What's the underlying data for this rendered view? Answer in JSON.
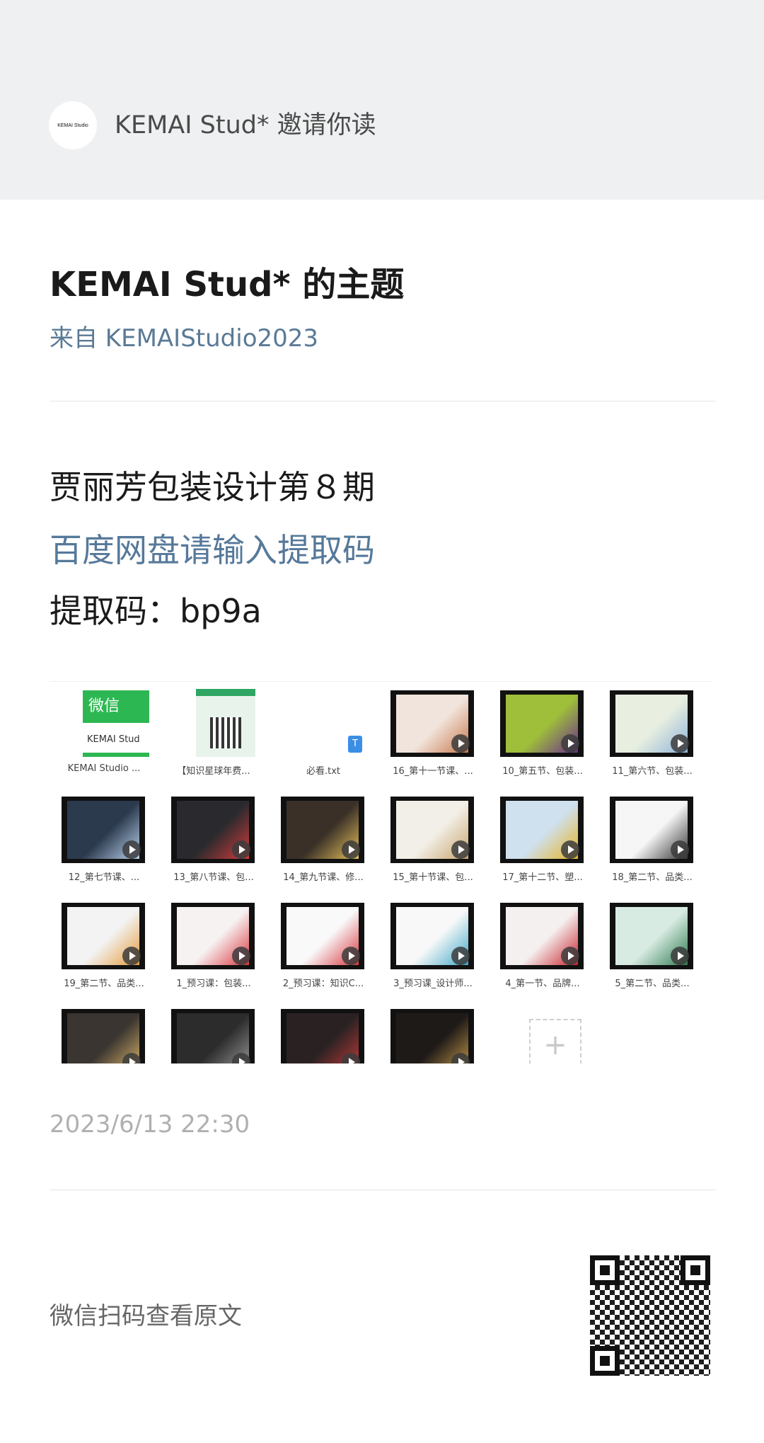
{
  "header": {
    "avatar_text": "KEMAI Studio",
    "invite_text": "KEMAI Stud* 邀请你读"
  },
  "topic": {
    "title": "KEMAI Stud* 的主题",
    "from": "来自 KEMAIStudio2023"
  },
  "post": {
    "title": "贾丽芳包装设计第８期",
    "link_text": "百度网盘请输入提取码",
    "code_text": "提取码：bp9a"
  },
  "files": [
    {
      "caption": "KEMAI Studio ...",
      "kind": "wechat-card",
      "card_top": "微信",
      "card_bottom": "KEMAI Stud"
    },
    {
      "caption": "【知识星球年费...",
      "kind": "qr-card"
    },
    {
      "caption": "必看.txt",
      "kind": "txt",
      "file_badge": "T"
    },
    {
      "caption": "16_第十一节课、...",
      "kind": "video",
      "thumb_color": "#f1e4dc",
      "accent": "#c7784a"
    },
    {
      "caption": "10_第五节、包装...",
      "kind": "video",
      "thumb_color": "#9fbf3a",
      "accent": "#6a2c8f"
    },
    {
      "caption": "11_第六节、包装...",
      "kind": "video",
      "thumb_color": "#e8efe0",
      "accent": "#8fb3d9"
    },
    {
      "caption": "12_第七节课、...",
      "kind": "video",
      "thumb_color": "#2c3a4e",
      "accent": "#b9d4ee"
    },
    {
      "caption": "13_第八节课、包...",
      "kind": "video",
      "thumb_color": "#2a2a2e",
      "accent": "#d33b3b"
    },
    {
      "caption": "14_第九节课、修...",
      "kind": "video",
      "thumb_color": "#3a3028",
      "accent": "#e6c15a"
    },
    {
      "caption": "15_第十节课、包...",
      "kind": "video",
      "thumb_color": "#f2efe8",
      "accent": "#c9a46a"
    },
    {
      "caption": "17_第十二节、塑...",
      "kind": "video",
      "thumb_color": "#cfe0ee",
      "accent": "#e6b422"
    },
    {
      "caption": "18_第二节、品类...",
      "kind": "video",
      "thumb_color": "#f6f6f6",
      "accent": "#333333"
    },
    {
      "caption": "19_第二节、品类...",
      "kind": "video",
      "thumb_color": "#f3f3f3",
      "accent": "#e39a3a"
    },
    {
      "caption": "1_预习课：包装...",
      "kind": "video",
      "thumb_color": "#f7f2f2",
      "accent": "#d9363e"
    },
    {
      "caption": "2_预习课：知识C...",
      "kind": "video",
      "thumb_color": "#f9f9f9",
      "accent": "#d9363e"
    },
    {
      "caption": "3_预习课_设计师...",
      "kind": "video",
      "thumb_color": "#f8f8f8",
      "accent": "#3fa8c9"
    },
    {
      "caption": "4_第一节、品牌...",
      "kind": "video",
      "thumb_color": "#f5f0f0",
      "accent": "#c8202a"
    },
    {
      "caption": "5_第二节、品类...",
      "kind": "video",
      "thumb_color": "#d8ebe2",
      "accent": "#2e7a4f"
    },
    {
      "caption": "",
      "kind": "video",
      "thumb_color": "#3a3530",
      "accent": "#d9b36a"
    },
    {
      "caption": "",
      "kind": "video",
      "thumb_color": "#2c2c2c",
      "accent": "#9a9a9a"
    },
    {
      "caption": "",
      "kind": "video",
      "thumb_color": "#2a2222",
      "accent": "#c23a3a"
    },
    {
      "caption": "",
      "kind": "video",
      "thumb_color": "#1e1a18",
      "accent": "#c79a4a"
    }
  ],
  "add_button": "+",
  "timestamp": "2023/6/13 22:30",
  "footer": {
    "scan_text": "微信扫码查看原文"
  }
}
